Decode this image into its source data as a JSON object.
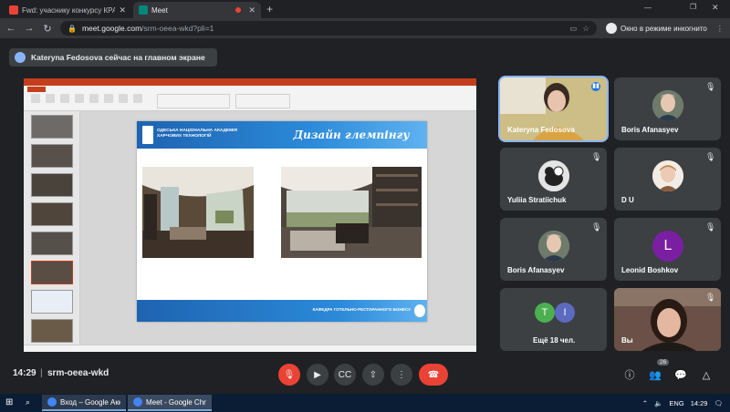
{
  "browser": {
    "tabs": [
      {
        "title": "Fwd: учаснику конкурсу КРАЩЕ",
        "active": false
      },
      {
        "title": "Meet",
        "active": true
      }
    ],
    "url_host": "meet.google.com",
    "url_path": "/srm-oeea-wkd?pli=1",
    "incognito_label": "Окно в режиме инкогнито"
  },
  "presenting": {
    "banner": "Kateryna Fedosova сейчас на главном экране"
  },
  "slide": {
    "org_name": "ОДЕСЬКА НАЦІОНАЛЬНА АКАДЕМІЯ ХАРЧОВИХ ТЕХНОЛОГІЙ",
    "title": "Дизайн глемпінгу",
    "footer": "КАФЕДРА ГОТЕЛЬНО-РЕСТОРАННОГО БІЗНЕСУ"
  },
  "participants": [
    {
      "name": "Kateryna Fedosova",
      "avatar": "video",
      "speaking": true
    },
    {
      "name": "Boris Afanasyev",
      "avatar": "photo",
      "muted": true
    },
    {
      "name": "Yuliia Stratiichuk",
      "avatar": "photo",
      "muted": true
    },
    {
      "name": "D U",
      "avatar": "photo",
      "muted": true
    },
    {
      "name": "Boris Afanasyev",
      "avatar": "photo",
      "muted": true
    },
    {
      "name": "Leonid Boshkov",
      "avatar": "L",
      "avatar_color": "#7b1fa2",
      "muted": true
    },
    {
      "name": "Ещё 18 чел.",
      "avatar": "T I",
      "avatar_colors": [
        "#4caf50",
        "#5c6bc0"
      ]
    },
    {
      "name": "Вы",
      "avatar": "video",
      "muted": true
    }
  ],
  "controls": {
    "time": "14:29",
    "separator": "|",
    "meeting_code": "srm-oeea-wkd",
    "participant_count": "26"
  },
  "taskbar": {
    "items": [
      {
        "label": "Вход – Google Аккаун"
      },
      {
        "label": "Meet - Google Chrom"
      }
    ],
    "lang": "ENG",
    "clock": "14:29"
  },
  "colors": {
    "accent_blue": "#8ab4f8",
    "end_call_red": "#ea4335",
    "ppt_red": "#c43e1c"
  }
}
